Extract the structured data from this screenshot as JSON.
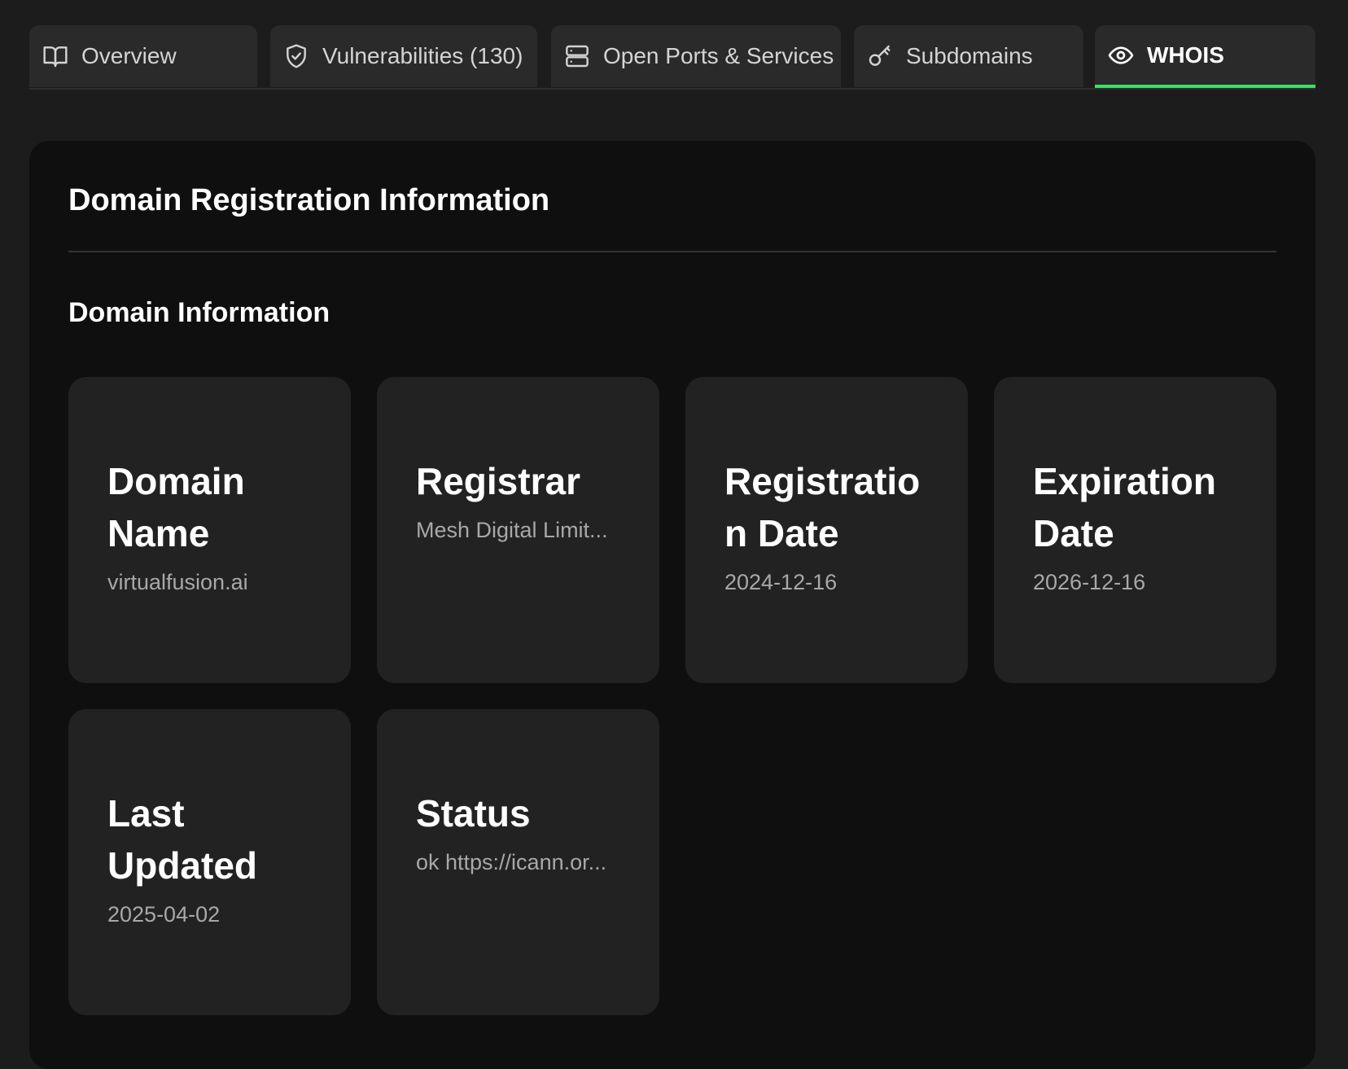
{
  "tabs": [
    {
      "label": "Overview",
      "icon": "book-open-icon"
    },
    {
      "label": "Vulnerabilities (130)",
      "icon": "shield-check-icon"
    },
    {
      "label": "Open Ports & Services",
      "icon": "server-icon"
    },
    {
      "label": "Subdomains",
      "icon": "key-icon"
    },
    {
      "label": "WHOIS",
      "icon": "eye-icon",
      "active": true
    }
  ],
  "panel": {
    "title": "Domain Registration Information",
    "section_title": "Domain Information"
  },
  "cards": [
    {
      "label": "Domain Name",
      "value": "virtualfusion.ai"
    },
    {
      "label": "Registrar",
      "value": "Mesh Digital Limit..."
    },
    {
      "label": "Registration Date",
      "value": "2024-12-16"
    },
    {
      "label": "Expiration Date",
      "value": "2026-12-16"
    },
    {
      "label": "Last Updated",
      "value": "2025-04-02"
    },
    {
      "label": "Status",
      "value": "ok https://icann.or..."
    }
  ],
  "colors": {
    "accent": "#3ddc68",
    "background": "#1c1c1c",
    "panel": "#0f0f0f",
    "card": "#222222"
  }
}
